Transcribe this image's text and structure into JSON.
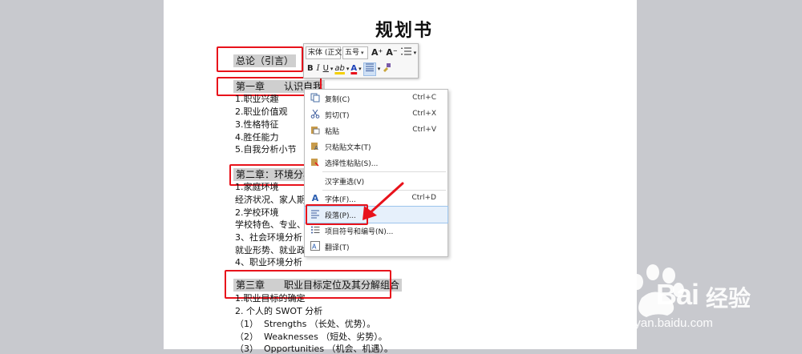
{
  "document": {
    "title": "规划书",
    "intro_heading": "总论（引言）",
    "chapter1_heading": "第一章　　认识自我",
    "chapter1_items": [
      "1.职业兴趣",
      "2.职业价值观",
      "3.性格特征",
      "4.胜任能力",
      "5.自我分析小节"
    ],
    "chapter2_heading": "第二章：环境分析",
    "chapter2_items": [
      "1.家庭环境",
      "经济状况、家人期望",
      "2.学校环境",
      "学校特色、专业、",
      "3、社会环境分析",
      "就业形势、就业政",
      "4、职业环境分析"
    ],
    "chapter3_heading": "第三章　　职业目标定位及其分解组合",
    "chapter3_items": [
      "1.职业目标的确定",
      "2. 个人的 SWOT 分析",
      "（1）  Strengths （长处、优势）。",
      "（2）  Weaknesses （短处、劣势）。",
      "（3）  Opportunities （机会、机遇）。"
    ]
  },
  "mini_toolbar": {
    "font_name": "宋体 (正文",
    "font_size": "五号",
    "grow_font": "A⁺",
    "shrink_font": "A⁻",
    "bold": "B",
    "italic": "I",
    "underline": "U",
    "highlight": "ab",
    "font_color": "A"
  },
  "context_menu": {
    "items": [
      {
        "label": "复制(C)",
        "shortcut": "Ctrl+C",
        "icon": "copy-icon"
      },
      {
        "label": "剪切(T)",
        "shortcut": "Ctrl+X",
        "icon": "scissors-icon"
      },
      {
        "label": "粘贴",
        "shortcut": "Ctrl+V",
        "icon": "paste-icon"
      },
      {
        "label": "只粘贴文本(T)",
        "shortcut": "",
        "icon": "paste-text-icon"
      },
      {
        "label": "选择性粘贴(S)...",
        "shortcut": "",
        "icon": "paste-special-icon"
      },
      {
        "label": "汉字重选(V)",
        "shortcut": "",
        "icon": ""
      },
      {
        "label": "字体(F)...",
        "shortcut": "Ctrl+D",
        "icon": "font-icon"
      },
      {
        "label": "段落(P)...",
        "shortcut": "",
        "icon": "paragraph-icon"
      },
      {
        "label": "项目符号和编号(N)...",
        "shortcut": "",
        "icon": "bullets-icon"
      },
      {
        "label": "翻译(T)",
        "shortcut": "",
        "icon": "translate-icon"
      }
    ]
  },
  "watermark": {
    "brand": "Bai",
    "brand_cn": "经验",
    "url": "jingyan.baidu.com"
  },
  "colors": {
    "annotation_red": "#e8121b",
    "page_bg": "#c8c9ce",
    "heading_highlight": "#cfcfcf"
  }
}
